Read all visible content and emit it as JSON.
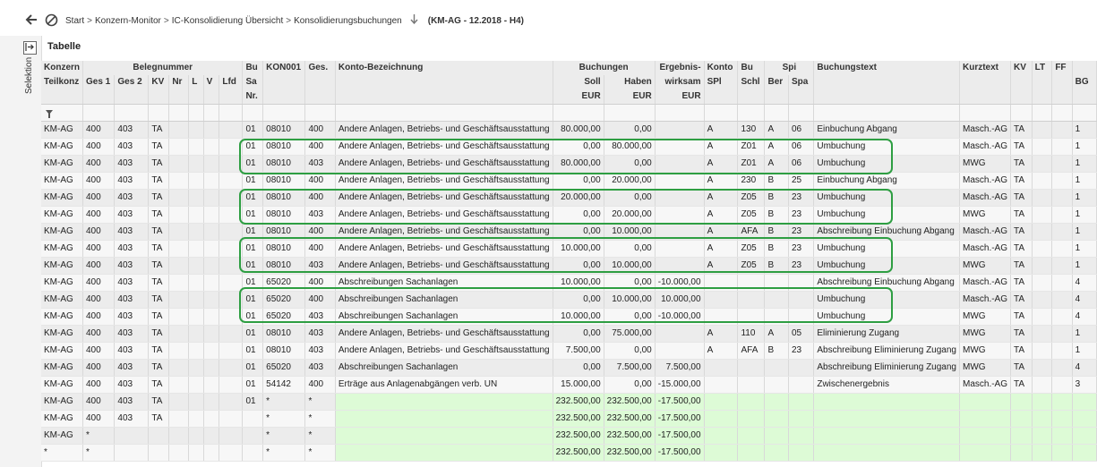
{
  "breadcrumb": {
    "items": [
      "Start",
      "Konzern-Monitor",
      "IC-Konsolidierung Übersicht",
      "Konsolidierungsbuchungen"
    ],
    "separator": ">",
    "context": "(KM-AG - 12.2018 - H4)"
  },
  "sidebar": {
    "label": "Selektion"
  },
  "panel": {
    "title": "Tabelle"
  },
  "colors": {
    "highlight": "#2e9e42",
    "sum_fill": "#ddfbd6",
    "header_bg": "#ececec"
  },
  "header": {
    "row1": {
      "konzern": "Konzern",
      "belegnummer": "Belegnummer",
      "bu": "Bu",
      "kon001": "KON001",
      "ges": "Ges.",
      "konto_bez": "Konto-Bezeichnung",
      "buchungen": "Buchungen",
      "ergebnis": "Ergebnis-",
      "konto": "Konto",
      "bu2": "Bu",
      "spi": "Spi",
      "buchungstext": "Buchungstext",
      "kurztext": "Kurztext",
      "kv": "KV",
      "lt": "LT",
      "ff": "FF"
    },
    "row2": {
      "teilkonz": "Teilkonz",
      "ges1": "Ges 1",
      "ges2": "Ges 2",
      "kv": "KV",
      "nr": "Nr",
      "l": "L",
      "v": "V",
      "lfd": "Lfd",
      "sa": "Sa",
      "soll": "Soll",
      "haben": "Haben",
      "wirksam": "wirksam",
      "spl": "SPl",
      "schl": "Schl",
      "ber": "Ber",
      "spa": "Spa",
      "bg": "BG"
    },
    "row3": {
      "nr": "Nr.",
      "eur_soll": "EUR",
      "eur_haben": "EUR",
      "eur_erg": "EUR"
    }
  },
  "rows": [
    {
      "konzern": "KM-AG",
      "ges1": "400",
      "ges2": "403",
      "kv": "TA",
      "bu": "01",
      "kon": "08010",
      "ges": "400",
      "bez": "Andere Anlagen, Betriebs- und Geschäftsausstattung",
      "soll": "80.000,00",
      "haben": "0,00",
      "erg": "",
      "konto": "A",
      "schl": "130",
      "ber": "A",
      "spa": "06",
      "text": "Einbuchung Abgang",
      "kurz": "Masch.-AG",
      "kv2": "TA",
      "bg": "1"
    },
    {
      "konzern": "KM-AG",
      "ges1": "400",
      "ges2": "403",
      "kv": "TA",
      "bu": "01",
      "kon": "08010",
      "ges": "400",
      "bez": "Andere Anlagen, Betriebs- und Geschäftsausstattung",
      "soll": "0,00",
      "haben": "80.000,00",
      "erg": "",
      "konto": "A",
      "schl": "Z01",
      "ber": "A",
      "spa": "06",
      "text": "Umbuchung",
      "kurz": "Masch.-AG",
      "kv2": "TA",
      "bg": "1"
    },
    {
      "konzern": "KM-AG",
      "ges1": "400",
      "ges2": "403",
      "kv": "TA",
      "bu": "01",
      "kon": "08010",
      "ges": "403",
      "bez": "Andere Anlagen, Betriebs- und Geschäftsausstattung",
      "soll": "80.000,00",
      "haben": "0,00",
      "erg": "",
      "konto": "A",
      "schl": "Z01",
      "ber": "A",
      "spa": "06",
      "text": "Umbuchung",
      "kurz": "MWG",
      "kv2": "TA",
      "bg": "1"
    },
    {
      "konzern": "KM-AG",
      "ges1": "400",
      "ges2": "403",
      "kv": "TA",
      "bu": "01",
      "kon": "08010",
      "ges": "400",
      "bez": "Andere Anlagen, Betriebs- und Geschäftsausstattung",
      "soll": "0,00",
      "haben": "20.000,00",
      "erg": "",
      "konto": "A",
      "schl": "230",
      "ber": "B",
      "spa": "25",
      "text": "Einbuchung Abgang",
      "kurz": "Masch.-AG",
      "kv2": "TA",
      "bg": "1"
    },
    {
      "konzern": "KM-AG",
      "ges1": "400",
      "ges2": "403",
      "kv": "TA",
      "bu": "01",
      "kon": "08010",
      "ges": "400",
      "bez": "Andere Anlagen, Betriebs- und Geschäftsausstattung",
      "soll": "20.000,00",
      "haben": "0,00",
      "erg": "",
      "konto": "A",
      "schl": "Z05",
      "ber": "B",
      "spa": "23",
      "text": "Umbuchung",
      "kurz": "Masch.-AG",
      "kv2": "TA",
      "bg": "1"
    },
    {
      "konzern": "KM-AG",
      "ges1": "400",
      "ges2": "403",
      "kv": "TA",
      "bu": "01",
      "kon": "08010",
      "ges": "403",
      "bez": "Andere Anlagen, Betriebs- und Geschäftsausstattung",
      "soll": "0,00",
      "haben": "20.000,00",
      "erg": "",
      "konto": "A",
      "schl": "Z05",
      "ber": "B",
      "spa": "23",
      "text": "Umbuchung",
      "kurz": "MWG",
      "kv2": "TA",
      "bg": "1"
    },
    {
      "konzern": "KM-AG",
      "ges1": "400",
      "ges2": "403",
      "kv": "TA",
      "bu": "01",
      "kon": "08010",
      "ges": "400",
      "bez": "Andere Anlagen, Betriebs- und Geschäftsausstattung",
      "soll": "0,00",
      "haben": "10.000,00",
      "erg": "",
      "konto": "A",
      "schl": "AFA",
      "ber": "B",
      "spa": "23",
      "text": "Abschreibung Einbuchung Abgang",
      "kurz": "Masch.-AG",
      "kv2": "TA",
      "bg": "1"
    },
    {
      "konzern": "KM-AG",
      "ges1": "400",
      "ges2": "403",
      "kv": "TA",
      "bu": "01",
      "kon": "08010",
      "ges": "400",
      "bez": "Andere Anlagen, Betriebs- und Geschäftsausstattung",
      "soll": "10.000,00",
      "haben": "0,00",
      "erg": "",
      "konto": "A",
      "schl": "Z05",
      "ber": "B",
      "spa": "23",
      "text": "Umbuchung",
      "kurz": "Masch.-AG",
      "kv2": "TA",
      "bg": "1"
    },
    {
      "konzern": "KM-AG",
      "ges1": "400",
      "ges2": "403",
      "kv": "TA",
      "bu": "01",
      "kon": "08010",
      "ges": "403",
      "bez": "Andere Anlagen, Betriebs- und Geschäftsausstattung",
      "soll": "0,00",
      "haben": "10.000,00",
      "erg": "",
      "konto": "A",
      "schl": "Z05",
      "ber": "B",
      "spa": "23",
      "text": "Umbuchung",
      "kurz": "MWG",
      "kv2": "TA",
      "bg": "1"
    },
    {
      "konzern": "KM-AG",
      "ges1": "400",
      "ges2": "403",
      "kv": "TA",
      "bu": "01",
      "kon": "65020",
      "ges": "400",
      "bez": "Abschreibungen Sachanlagen",
      "soll": "10.000,00",
      "haben": "0,00",
      "erg": "-10.000,00",
      "konto": "",
      "schl": "",
      "ber": "",
      "spa": "",
      "text": "Abschreibung Einbuchung Abgang",
      "kurz": "Masch.-AG",
      "kv2": "TA",
      "bg": "4"
    },
    {
      "konzern": "KM-AG",
      "ges1": "400",
      "ges2": "403",
      "kv": "TA",
      "bu": "01",
      "kon": "65020",
      "ges": "400",
      "bez": "Abschreibungen Sachanlagen",
      "soll": "0,00",
      "haben": "10.000,00",
      "erg": "10.000,00",
      "konto": "",
      "schl": "",
      "ber": "",
      "spa": "",
      "text": "Umbuchung",
      "kurz": "Masch.-AG",
      "kv2": "TA",
      "bg": "4"
    },
    {
      "konzern": "KM-AG",
      "ges1": "400",
      "ges2": "403",
      "kv": "TA",
      "bu": "01",
      "kon": "65020",
      "ges": "403",
      "bez": "Abschreibungen Sachanlagen",
      "soll": "10.000,00",
      "haben": "0,00",
      "erg": "-10.000,00",
      "konto": "",
      "schl": "",
      "ber": "",
      "spa": "",
      "text": "Umbuchung",
      "kurz": "MWG",
      "kv2": "TA",
      "bg": "4"
    },
    {
      "konzern": "KM-AG",
      "ges1": "400",
      "ges2": "403",
      "kv": "TA",
      "bu": "01",
      "kon": "08010",
      "ges": "403",
      "bez": "Andere Anlagen, Betriebs- und Geschäftsausstattung",
      "soll": "0,00",
      "haben": "75.000,00",
      "erg": "",
      "konto": "A",
      "schl": "110",
      "ber": "A",
      "spa": "05",
      "text": "Eliminierung Zugang",
      "kurz": "MWG",
      "kv2": "TA",
      "bg": "1"
    },
    {
      "konzern": "KM-AG",
      "ges1": "400",
      "ges2": "403",
      "kv": "TA",
      "bu": "01",
      "kon": "08010",
      "ges": "403",
      "bez": "Andere Anlagen, Betriebs- und Geschäftsausstattung",
      "soll": "7.500,00",
      "haben": "0,00",
      "erg": "",
      "konto": "A",
      "schl": "AFA",
      "ber": "B",
      "spa": "23",
      "text": "Abschreibung Eliminierung Zugang",
      "kurz": "MWG",
      "kv2": "TA",
      "bg": "1"
    },
    {
      "konzern": "KM-AG",
      "ges1": "400",
      "ges2": "403",
      "kv": "TA",
      "bu": "01",
      "kon": "65020",
      "ges": "403",
      "bez": "Abschreibungen Sachanlagen",
      "soll": "0,00",
      "haben": "7.500,00",
      "erg": "7.500,00",
      "konto": "",
      "schl": "",
      "ber": "",
      "spa": "",
      "text": "Abschreibung Eliminierung Zugang",
      "kurz": "MWG",
      "kv2": "TA",
      "bg": "4"
    },
    {
      "konzern": "KM-AG",
      "ges1": "400",
      "ges2": "403",
      "kv": "TA",
      "bu": "01",
      "kon": "54142",
      "ges": "400",
      "bez": "Erträge aus Anlagenabgängen verb. UN",
      "soll": "15.000,00",
      "haben": "0,00",
      "erg": "-15.000,00",
      "konto": "",
      "schl": "",
      "ber": "",
      "spa": "",
      "text": "Zwischenergebnis",
      "kurz": "Masch.-AG",
      "kv2": "TA",
      "bg": "3"
    }
  ],
  "sums": [
    {
      "konzern": "KM-AG",
      "ges1": "400",
      "ges2": "403",
      "kv": "TA",
      "bu": "01",
      "kon": "*",
      "ges": "*",
      "soll": "232.500,00",
      "haben": "232.500,00",
      "erg": "-17.500,00"
    },
    {
      "konzern": "KM-AG",
      "ges1": "400",
      "ges2": "403",
      "kv": "TA",
      "bu": "",
      "kon": "*",
      "ges": "*",
      "soll": "232.500,00",
      "haben": "232.500,00",
      "erg": "-17.500,00"
    },
    {
      "konzern": "KM-AG",
      "ges1": "*",
      "ges2": "",
      "kv": "",
      "bu": "",
      "kon": "*",
      "ges": "*",
      "soll": "232.500,00",
      "haben": "232.500,00",
      "erg": "-17.500,00"
    },
    {
      "konzern": "*",
      "ges1": "*",
      "ges2": "",
      "kv": "",
      "bu": "",
      "kon": "*",
      "ges": "*",
      "soll": "232.500,00",
      "haben": "232.500,00",
      "erg": "-17.500,00"
    }
  ]
}
